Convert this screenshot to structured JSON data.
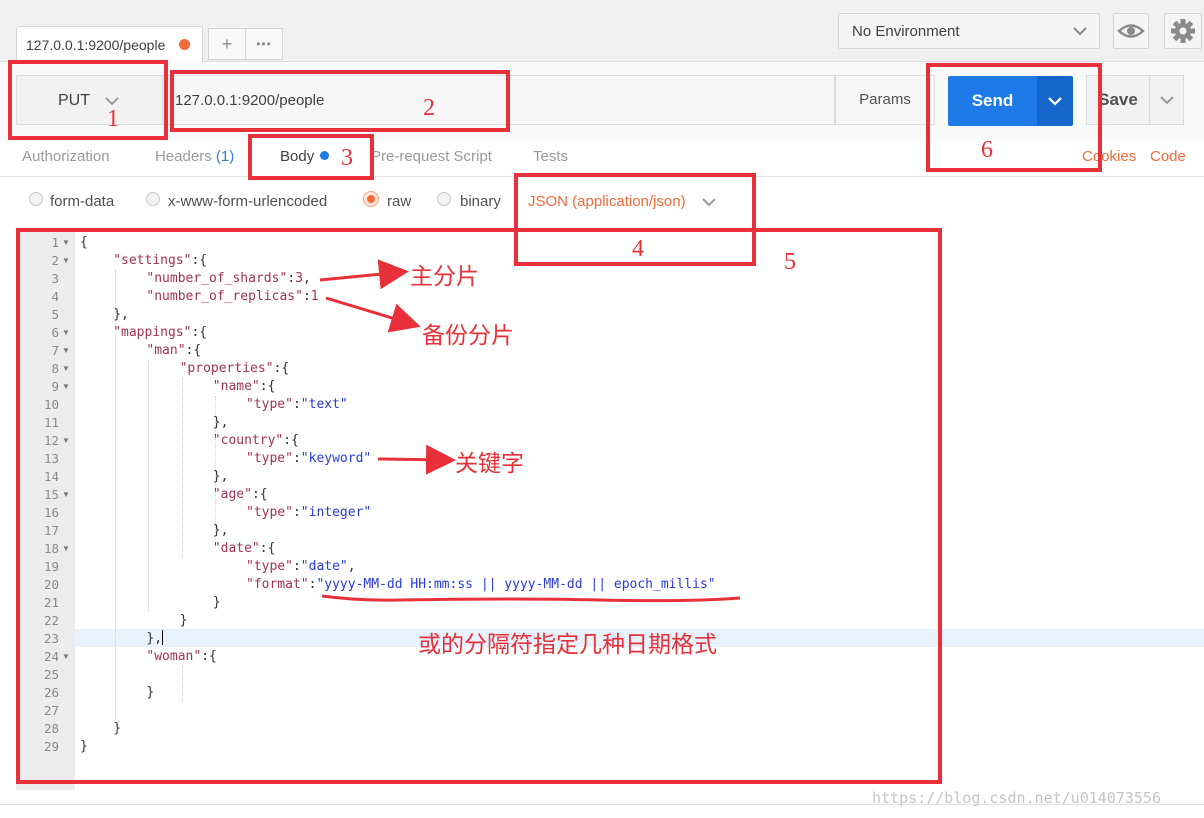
{
  "tab": {
    "label": "127.0.0.1:9200/people",
    "new_tab": "+",
    "more": "•••"
  },
  "environment": {
    "label": "No Environment"
  },
  "request": {
    "method": "PUT",
    "url": "127.0.0.1:9200/people",
    "params_label": "Params",
    "send_label": "Send",
    "save_label": "Save"
  },
  "subtabs": {
    "authorization": "Authorization",
    "headers": "Headers",
    "headers_count": "(1)",
    "body": "Body",
    "prerequest": "Pre-request Script",
    "tests": "Tests",
    "cookies": "Cookies",
    "code": "Code"
  },
  "body_types": {
    "form_data": "form-data",
    "urlencoded": "x-www-form-urlencoded",
    "raw": "raw",
    "binary": "binary",
    "content_type": "JSON (application/json)"
  },
  "editor": {
    "lines": [
      {
        "n": "1",
        "fold": true,
        "indent": 0,
        "parts": [
          [
            "p",
            "{"
          ]
        ]
      },
      {
        "n": "2",
        "fold": true,
        "indent": 1,
        "parts": [
          [
            "k",
            "\"settings\""
          ],
          [
            "p",
            ":{"
          ]
        ]
      },
      {
        "n": "3",
        "fold": false,
        "indent": 2,
        "parts": [
          [
            "k",
            "\"number_of_shards\""
          ],
          [
            "p",
            ":"
          ],
          [
            "n",
            "3"
          ],
          [
            "p",
            ","
          ]
        ]
      },
      {
        "n": "4",
        "fold": false,
        "indent": 2,
        "parts": [
          [
            "k",
            "\"number_of_replicas\""
          ],
          [
            "p",
            ":"
          ],
          [
            "n",
            "1"
          ]
        ]
      },
      {
        "n": "5",
        "fold": false,
        "indent": 1,
        "parts": [
          [
            "p",
            "},"
          ]
        ]
      },
      {
        "n": "6",
        "fold": true,
        "indent": 1,
        "parts": [
          [
            "k",
            "\"mappings\""
          ],
          [
            "p",
            ":{"
          ]
        ]
      },
      {
        "n": "7",
        "fold": true,
        "indent": 2,
        "parts": [
          [
            "k",
            "\"man\""
          ],
          [
            "p",
            ":{"
          ]
        ]
      },
      {
        "n": "8",
        "fold": true,
        "indent": 3,
        "parts": [
          [
            "k",
            "\"properties\""
          ],
          [
            "p",
            ":{"
          ]
        ]
      },
      {
        "n": "9",
        "fold": true,
        "indent": 4,
        "parts": [
          [
            "k",
            "\"name\""
          ],
          [
            "p",
            ":{"
          ]
        ]
      },
      {
        "n": "10",
        "fold": false,
        "indent": 5,
        "parts": [
          [
            "k",
            "\"type\""
          ],
          [
            "p",
            ":"
          ],
          [
            "s",
            "\"text\""
          ]
        ]
      },
      {
        "n": "11",
        "fold": false,
        "indent": 4,
        "parts": [
          [
            "p",
            "},"
          ]
        ]
      },
      {
        "n": "12",
        "fold": true,
        "indent": 4,
        "parts": [
          [
            "k",
            "\"country\""
          ],
          [
            "p",
            ":{"
          ]
        ]
      },
      {
        "n": "13",
        "fold": false,
        "indent": 5,
        "parts": [
          [
            "k",
            "\"type\""
          ],
          [
            "p",
            ":"
          ],
          [
            "s",
            "\"keyword\""
          ]
        ]
      },
      {
        "n": "14",
        "fold": false,
        "indent": 4,
        "parts": [
          [
            "p",
            "},"
          ]
        ]
      },
      {
        "n": "15",
        "fold": true,
        "indent": 4,
        "parts": [
          [
            "k",
            "\"age\""
          ],
          [
            "p",
            ":{"
          ]
        ]
      },
      {
        "n": "16",
        "fold": false,
        "indent": 5,
        "parts": [
          [
            "k",
            "\"type\""
          ],
          [
            "p",
            ":"
          ],
          [
            "s",
            "\"integer\""
          ]
        ]
      },
      {
        "n": "17",
        "fold": false,
        "indent": 4,
        "parts": [
          [
            "p",
            "},"
          ]
        ]
      },
      {
        "n": "18",
        "fold": true,
        "indent": 4,
        "parts": [
          [
            "k",
            "\"date\""
          ],
          [
            "p",
            ":{"
          ]
        ]
      },
      {
        "n": "19",
        "fold": false,
        "indent": 5,
        "parts": [
          [
            "k",
            "\"type\""
          ],
          [
            "p",
            ":"
          ],
          [
            "s",
            "\"date\""
          ],
          [
            "p",
            ","
          ]
        ]
      },
      {
        "n": "20",
        "fold": false,
        "indent": 5,
        "parts": [
          [
            "k",
            "\"format\""
          ],
          [
            "p",
            ":"
          ],
          [
            "s",
            "\"yyyy-MM-dd HH:mm:ss || yyyy-MM-dd || epoch_millis\""
          ]
        ]
      },
      {
        "n": "21",
        "fold": false,
        "indent": 4,
        "parts": [
          [
            "p",
            "}"
          ]
        ]
      },
      {
        "n": "22",
        "fold": false,
        "indent": 3,
        "parts": [
          [
            "p",
            "}"
          ]
        ]
      },
      {
        "n": "23",
        "fold": false,
        "indent": 2,
        "parts": [
          [
            "p",
            "},"
          ]
        ]
      },
      {
        "n": "24",
        "fold": true,
        "indent": 2,
        "parts": [
          [
            "k",
            "\"woman\""
          ],
          [
            "p",
            ":{"
          ]
        ]
      },
      {
        "n": "25",
        "fold": false,
        "indent": 2,
        "parts": []
      },
      {
        "n": "26",
        "fold": false,
        "indent": 2,
        "parts": [
          [
            "p",
            "}"
          ]
        ]
      },
      {
        "n": "27",
        "fold": false,
        "indent": 1,
        "parts": []
      },
      {
        "n": "28",
        "fold": false,
        "indent": 1,
        "parts": [
          [
            "p",
            "}"
          ]
        ]
      },
      {
        "n": "29",
        "fold": false,
        "indent": 0,
        "parts": [
          [
            "p",
            "}"
          ]
        ]
      }
    ]
  },
  "annotations": {
    "markers": [
      "1",
      "2",
      "3",
      "4",
      "5",
      "6"
    ],
    "notes": {
      "primary_shards": "主分片",
      "replica_shards": "备份分片",
      "keyword": "关键字",
      "date_format": "或的分隔符指定几种日期格式"
    },
    "color": "#e8303a"
  },
  "watermark": "https://blog.csdn.net/u014073556",
  "colors": {
    "send": "#1e7ae6",
    "accent_orange": "#f26b3a",
    "json_key": "#a0325a",
    "json_string": "#2a3bd8"
  }
}
